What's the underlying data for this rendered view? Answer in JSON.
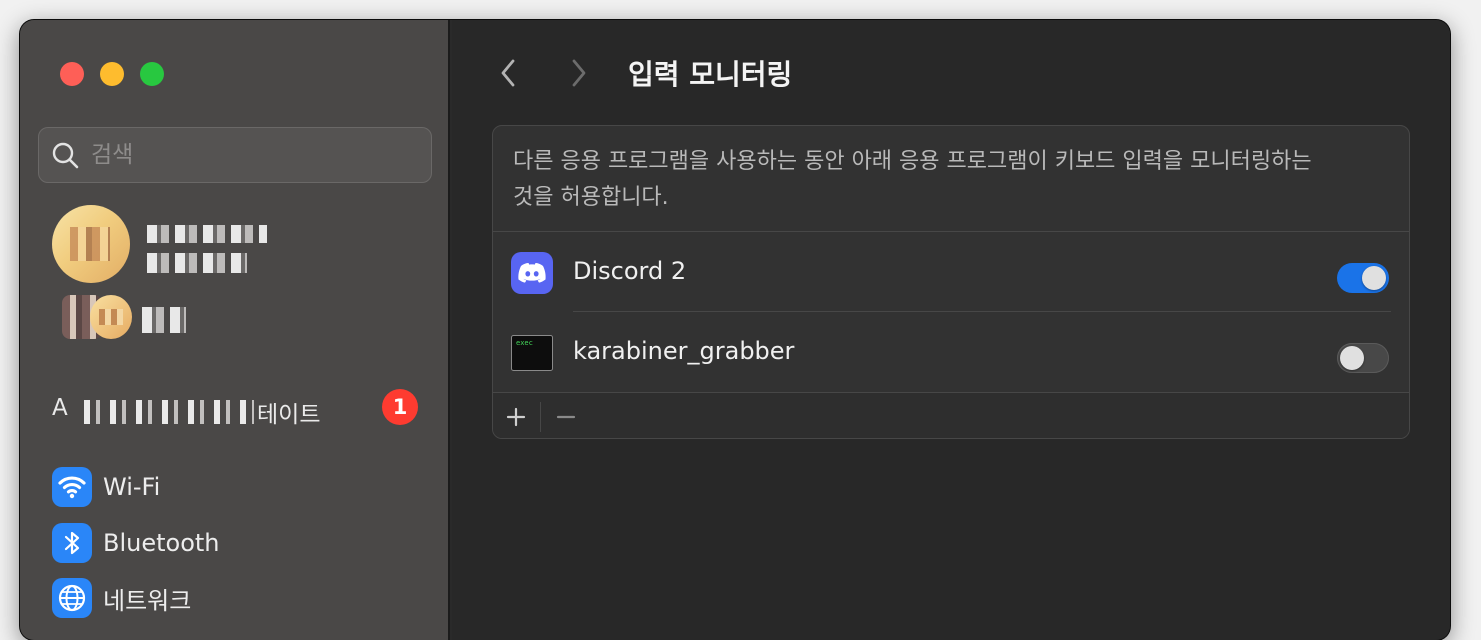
{
  "sidebar": {
    "search_placeholder": "검색",
    "update": {
      "prefix": "A",
      "suffix": "테이트",
      "badge": "1"
    },
    "items": [
      {
        "label": "Wi-Fi",
        "icon": "wifi-icon"
      },
      {
        "label": "Bluetooth",
        "icon": "bluetooth-icon"
      },
      {
        "label": "네트워크",
        "icon": "globe-icon"
      }
    ]
  },
  "header": {
    "title": "입력 모니터링"
  },
  "panel": {
    "description": "다른 응용 프로그램을 사용하는 동안 아래 응용 프로그램이 키보드 입력을 모니터링하는 것을 허용합니다.",
    "apps": [
      {
        "name": "Discord 2",
        "icon": "discord-icon",
        "enabled": true
      },
      {
        "name": "karabiner_grabber",
        "icon": "exec-icon",
        "icon_text": "exec",
        "enabled": false
      }
    ],
    "add_label": "+",
    "remove_label": "−"
  },
  "colors": {
    "accent": "#1a73e8",
    "badge": "#fe3b30",
    "discord": "#5865f2",
    "sidebar_bg": "#4a4847",
    "content_bg": "#282828"
  }
}
